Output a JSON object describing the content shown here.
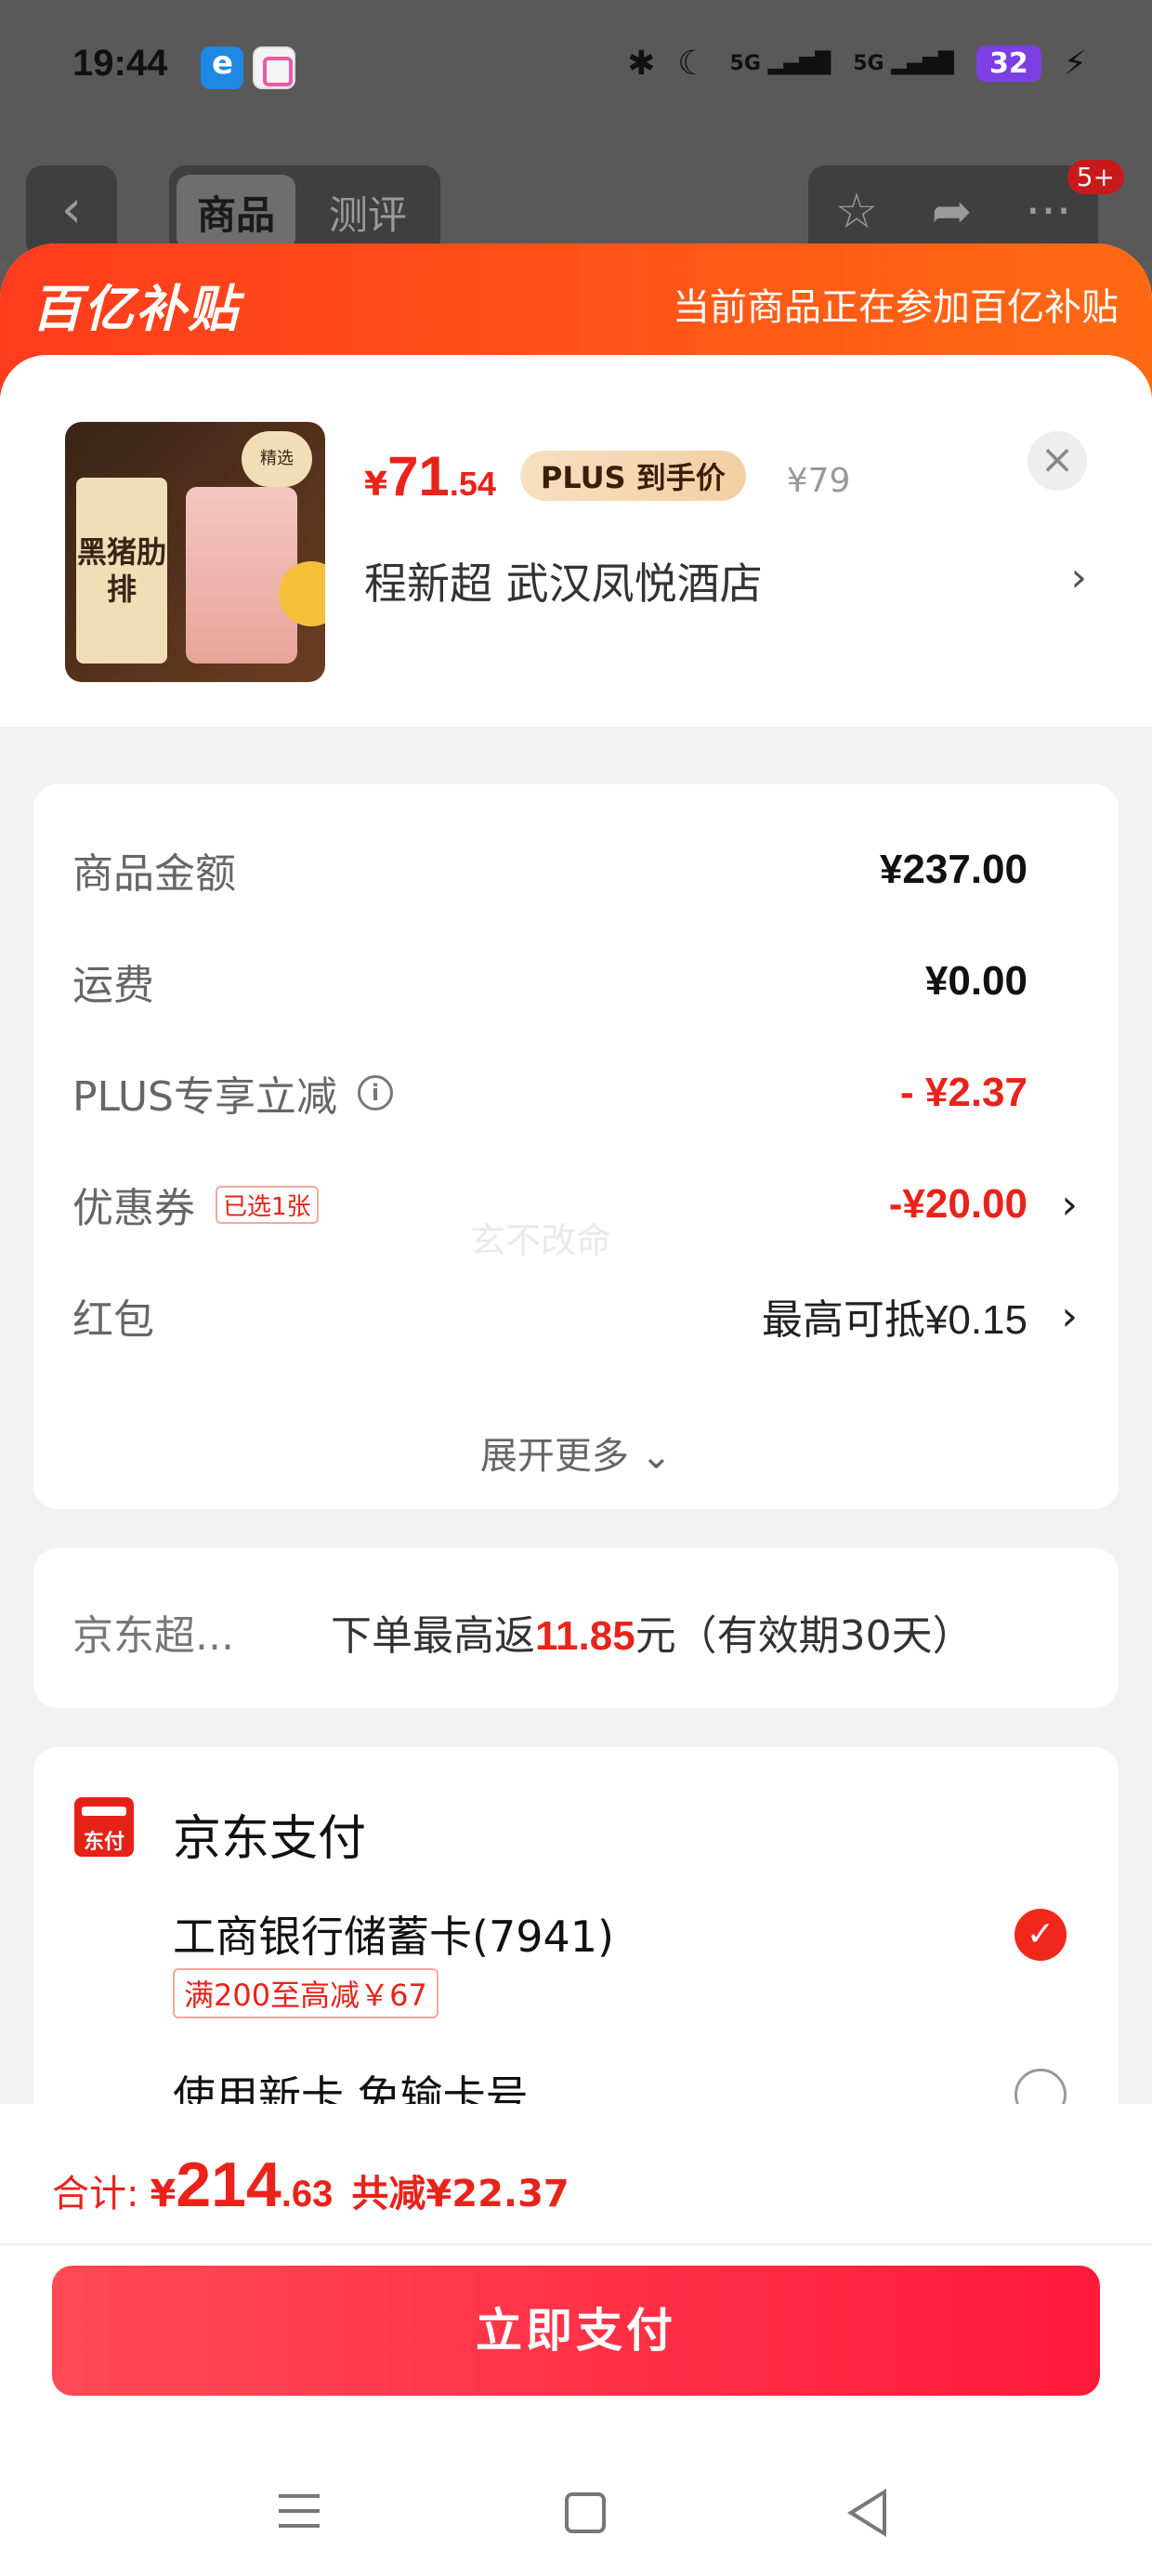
{
  "status_bar": {
    "time": "19:44",
    "network1": "5G",
    "network2": "5G",
    "battery": "32",
    "icons": [
      "bluetooth-icon",
      "moon-icon",
      "signal-icon",
      "signal-icon",
      "battery-icon",
      "charging-icon"
    ]
  },
  "top_nav": {
    "back_icon": "chevron-left-icon",
    "tabs": [
      {
        "label": "商品",
        "active": true
      },
      {
        "label": "测评",
        "active": false
      }
    ],
    "actions": [
      "star-icon",
      "share-icon",
      "more-icon"
    ],
    "badge": "5+"
  },
  "banner": {
    "logo": "百亿补贴",
    "note": "当前商品正在参加百亿补贴",
    "color_start": "#ff3b1d",
    "color_end": "#ff6a13"
  },
  "product": {
    "thumb_label": "黑猪肋排",
    "thumb_badge": "精选",
    "price_yen": "¥",
    "price_int": "71",
    "price_dec": ".54",
    "plus_tag": "PLUS 到手价",
    "orig_price": "¥79",
    "store": "程新超  武汉凤悦酒店",
    "close_icon": "close-icon"
  },
  "costs": {
    "rows": [
      {
        "label": "商品金额",
        "value": "¥237.00"
      },
      {
        "label": "运费",
        "value": "¥0.00"
      },
      {
        "label": "PLUS专享立减",
        "value": "- ¥2.37"
      },
      {
        "label": "优惠券",
        "tag": "已选1张",
        "value": "-¥20.00"
      },
      {
        "label": "红包",
        "value": "最高可抵¥0.15"
      }
    ],
    "watermark": "玄不改命",
    "expand": "展开更多 ⌄"
  },
  "rebate": {
    "label": "京东超...",
    "text_pre": "下单最高返",
    "amount": "11.85",
    "text_post": "元（有效期30天）"
  },
  "payment": {
    "title": "京东支付",
    "logo_text": "东付",
    "options": [
      {
        "label": "工商银行储蓄卡(7941)",
        "promo": "满200至高减￥67",
        "selected": true
      },
      {
        "label": "使用新卡 免输卡号",
        "selected": false
      }
    ]
  },
  "footer": {
    "total_label": "合计:",
    "total_yen": "¥",
    "total_int": "214",
    "total_dec": ".63",
    "total_save": "共减¥22.37",
    "pay_button": "立即支付",
    "accent": "#e8231a"
  }
}
